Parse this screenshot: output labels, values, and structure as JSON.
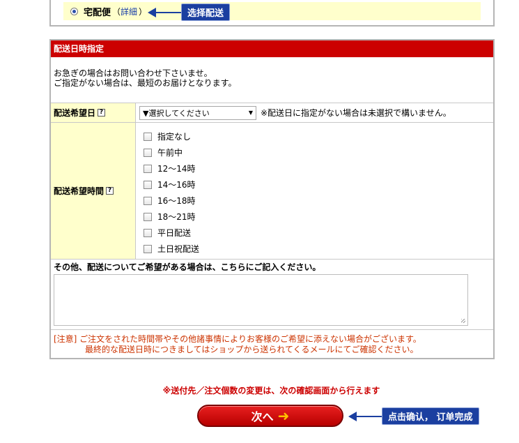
{
  "shipping": {
    "method_label": "宅配便",
    "paren_open": "（",
    "details_link": "詳細",
    "paren_close": "）",
    "callout": "选择配送"
  },
  "delivery": {
    "header": "配送日時指定",
    "note_line1": "お急ぎの場合はお問い合わせ下さいませ。",
    "note_line2": "ご指定がない場合は、最短のお届けとなります。",
    "date": {
      "label": "配送希望日",
      "select_value": "▼選択してください",
      "hint": "※配送日に指定がない場合は未選択で構いません。"
    },
    "time": {
      "label": "配送希望時間",
      "options": [
        "指定なし",
        "午前中",
        "12〜14時",
        "14〜16時",
        "16〜18時",
        "18〜21時",
        "平日配送",
        "土日祝配送"
      ]
    },
    "other_label": "その他、配送についてご希望がある場合は、こちらにご記入ください。",
    "caution_line1": "[注意] ご注文をされた時間帯やその他諸事情によりお客様のご希望に添えない場合がございます。",
    "caution_line2": "最終的な配送日時につきましてはショップから送られてくるメールにてご確認ください。"
  },
  "footer": {
    "change_note": "※送付先／注文個数の変更は、次の確認画面から行えます",
    "next_label": "次へ",
    "next_arrow": "➜",
    "callout": "点击确认， 订单完成"
  },
  "colors": {
    "header_red": "#cc0000",
    "label_bg": "#ffffcc",
    "callout_blue": "#1b3fa0"
  }
}
